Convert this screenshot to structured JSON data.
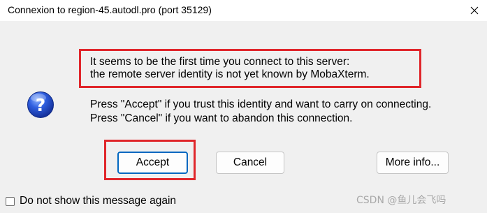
{
  "window": {
    "title": "Connexion to region-45.autodl.pro (port 35129)",
    "close_icon": "close-icon"
  },
  "message": {
    "warning_line1": "It seems to be the first time you connect to this server:",
    "warning_line2": "the remote server identity is not yet known by MobaXterm.",
    "instruction_line1": "Press \"Accept\" if you trust this identity and want to carry on connecting.",
    "instruction_line2": "Press \"Cancel\" if you want to abandon this connection.",
    "icon": "question-icon"
  },
  "buttons": {
    "accept": "Accept",
    "cancel": "Cancel",
    "more_info": "More info..."
  },
  "checkbox": {
    "label": "Do not show this message again",
    "checked": false
  },
  "watermark": "CSDN @鱼儿会飞吗",
  "colors": {
    "highlight_box": "#e0262b",
    "default_button_border": "#0067c0",
    "dialog_background": "#f0f0f0"
  }
}
